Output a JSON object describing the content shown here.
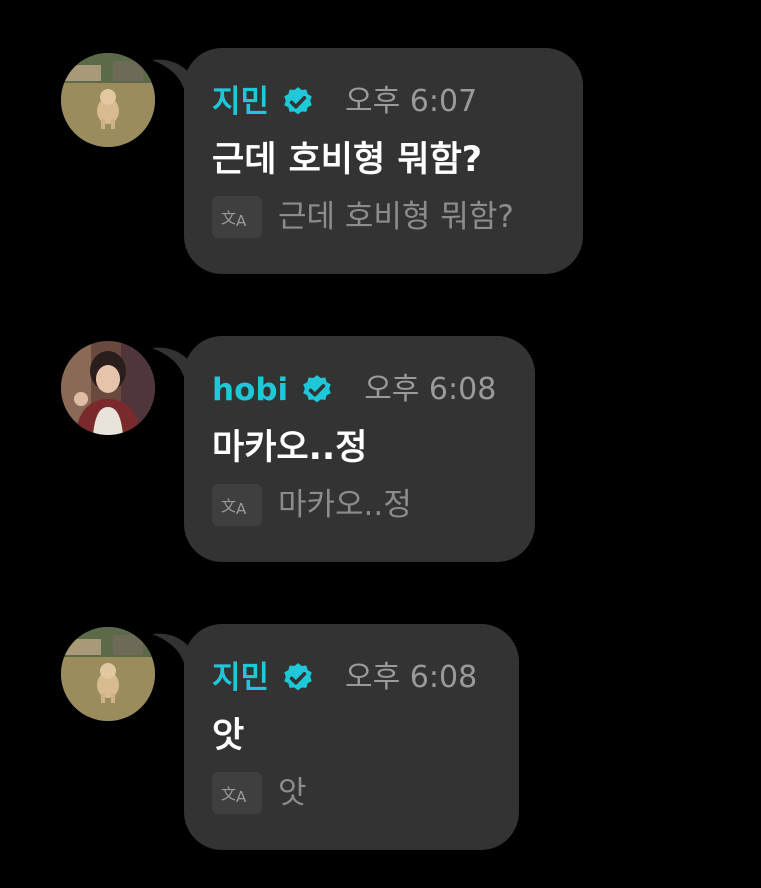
{
  "colors": {
    "background": "#000000",
    "bubble": "#333333",
    "name": "#1fc8d8",
    "verified_badge": "#1fc8d8",
    "time": "#9a9a9a",
    "message": "#ffffff",
    "translation": "#8c8c8c"
  },
  "messages": [
    {
      "sender": "지민",
      "verified": true,
      "avatar": "puppy-photo",
      "time": "오후 6:07",
      "text": "근데 호비형 뭐함?",
      "translation": "근데 호비형 뭐함?"
    },
    {
      "sender": "hobi",
      "verified": true,
      "avatar": "person-photo",
      "time": "오후 6:08",
      "text": "마카오..정",
      "translation": "마카오..정"
    },
    {
      "sender": "지민",
      "verified": true,
      "avatar": "puppy-photo",
      "time": "오후 6:08",
      "text": "앗",
      "translation": "앗"
    }
  ]
}
